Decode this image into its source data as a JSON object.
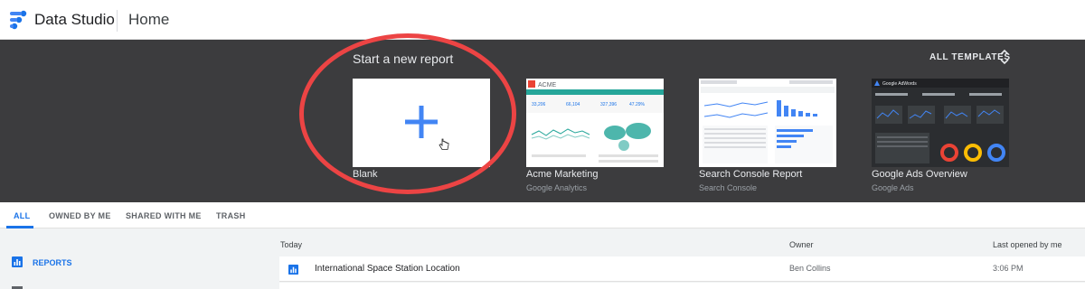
{
  "header": {
    "app_name": "Data Studio",
    "page_name": "Home",
    "logo_icon": "data-studio-logo-icon"
  },
  "gallery": {
    "title": "Start a new report",
    "all_templates_label": "ALL TEMPLATES",
    "templates": [
      {
        "name": "Blank",
        "source": ""
      },
      {
        "name": "Acme Marketing",
        "source": "Google Analytics"
      },
      {
        "name": "Search Console Report",
        "source": "Search Console"
      },
      {
        "name": "Google Ads Overview",
        "source": "Google Ads"
      }
    ],
    "thumb_text": {
      "acme_logo": "ACME",
      "acme_kpis": [
        "33,206",
        "66,104",
        "327,396",
        "47.29%"
      ],
      "ads_brand": "Google AdWords"
    }
  },
  "tabs": [
    {
      "label": "ALL",
      "active": true
    },
    {
      "label": "OWNED BY ME",
      "active": false
    },
    {
      "label": "SHARED WITH ME",
      "active": false
    },
    {
      "label": "TRASH",
      "active": false
    }
  ],
  "sidebar": {
    "items": [
      {
        "label": "REPORTS",
        "icon": "bar-chart-icon",
        "active": true
      }
    ]
  },
  "list": {
    "columns": {
      "name": "Today",
      "owner": "Owner",
      "last_opened": "Last opened by me"
    },
    "rows": [
      {
        "name": "International Space Station Location",
        "owner": "Ben Collins",
        "last_opened": "3:06 PM",
        "icon": "report-icon"
      }
    ]
  },
  "colors": {
    "accent": "#1a73e8",
    "gallery_bg": "#3c3c3e",
    "highlight_circle": "#ec4444"
  }
}
